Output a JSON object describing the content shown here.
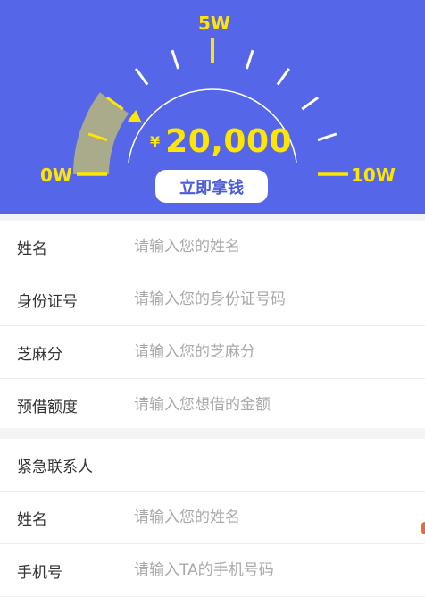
{
  "gauge": {
    "min_label": "0W",
    "mid_label": "5W",
    "max_label": "10W",
    "currency": "¥",
    "amount": "20,000",
    "level_fraction": 0.2,
    "accent_color": "#ffe600",
    "fill_color": "#a9ab8a",
    "background_color": "#5566e8"
  },
  "cta": {
    "label": "立即拿钱"
  },
  "form": {
    "fields": [
      {
        "label": "姓名",
        "placeholder": "请输入您的姓名"
      },
      {
        "label": "身份证号",
        "placeholder": "请输入您的身份证号码"
      },
      {
        "label": "芝麻分",
        "placeholder": "请输入您的芝麻分"
      },
      {
        "label": "预借额度",
        "placeholder": "请输入您想借的金额"
      }
    ]
  },
  "emergency": {
    "title": "紧急联系人",
    "fields": [
      {
        "label": "姓名",
        "placeholder": "请输入您的姓名"
      },
      {
        "label": "手机号",
        "placeholder": "请输入TA的手机号码"
      }
    ]
  }
}
